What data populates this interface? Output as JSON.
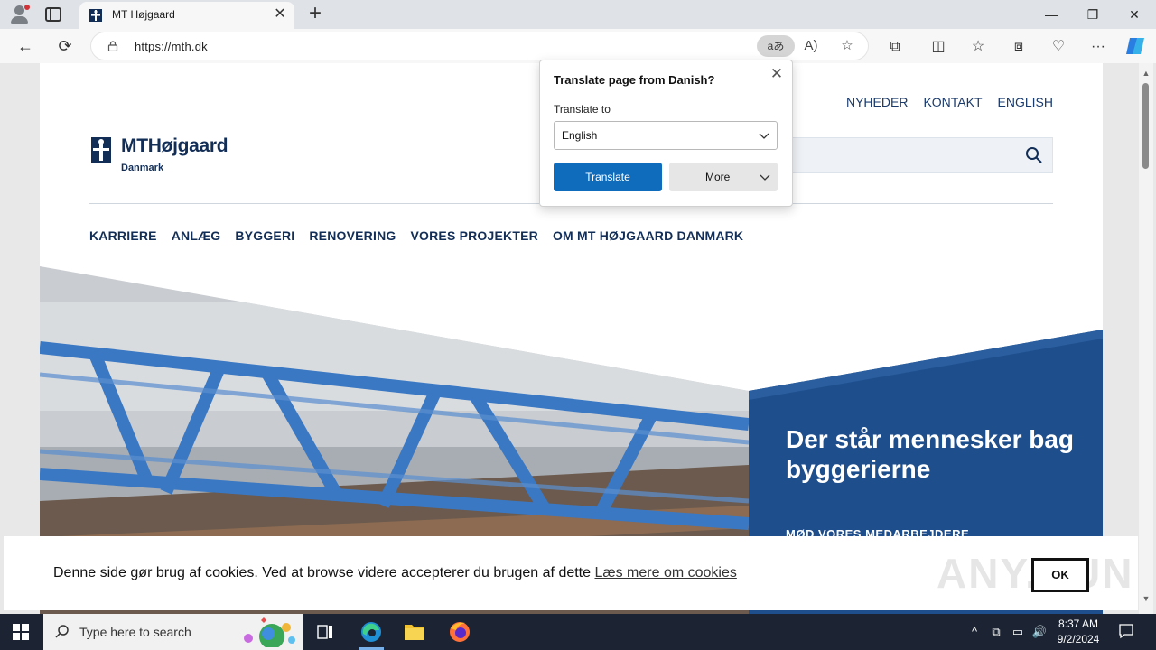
{
  "browser": {
    "tab_title": "MT Højgaard",
    "url": "https://mth.dk",
    "translate_pill_glyph": "aあ",
    "read_aloud_glyph": "A)",
    "tab_close_glyph": "✕",
    "new_tab_glyph": "+",
    "window_controls": {
      "minimize": "—",
      "restore": "❐",
      "close": "✕"
    },
    "nav": {
      "back": "←",
      "refresh": "⟳"
    },
    "toolbar_glyphs": {
      "favorite": "☆",
      "extensions": "⧉",
      "split": "◫",
      "favorites": "☆",
      "collections": "⧈",
      "performance": "♡",
      "menu": "···"
    }
  },
  "site": {
    "top_links": [
      "NYHEDER",
      "KONTAKT",
      "ENGLISH"
    ],
    "logo": {
      "brand": "MTHøjgaard",
      "sub": "Danmark"
    },
    "main_nav": [
      "KARRIERE",
      "ANLÆG",
      "BYGGERI",
      "RENOVERING",
      "VORES PROJEKTER",
      "OM MT HØJGAARD DANMARK"
    ],
    "hero": {
      "title": "Der står mennesker bag byggerierne",
      "subtitle": "MØD VORES MEDARBEJDERE"
    },
    "cookie": {
      "text": "Denne side gør brug af cookies. Ved at browse videre accepterer du brugen af dette ",
      "link": "Læs mere om cookies",
      "ok": "OK",
      "watermark": "ANY.RUN"
    },
    "scrollbar": {
      "up": "▲",
      "down": "▼"
    }
  },
  "translate_popup": {
    "title": "Translate page from Danish?",
    "close": "✕",
    "label": "Translate to",
    "selected_language": "English",
    "translate_button": "Translate",
    "more_button": "More"
  },
  "taskbar": {
    "search_placeholder": "Type here to search",
    "time": "8:37 AM",
    "date": "9/2/2024",
    "tray_glyphs": {
      "chevron": "^",
      "meet": "⧉",
      "network": "▭",
      "volume": "🔊"
    }
  },
  "colors": {
    "brand_navy": "#122e57",
    "hero_blue": "#1f4e8c",
    "edge_blue": "#0f6cbd"
  }
}
